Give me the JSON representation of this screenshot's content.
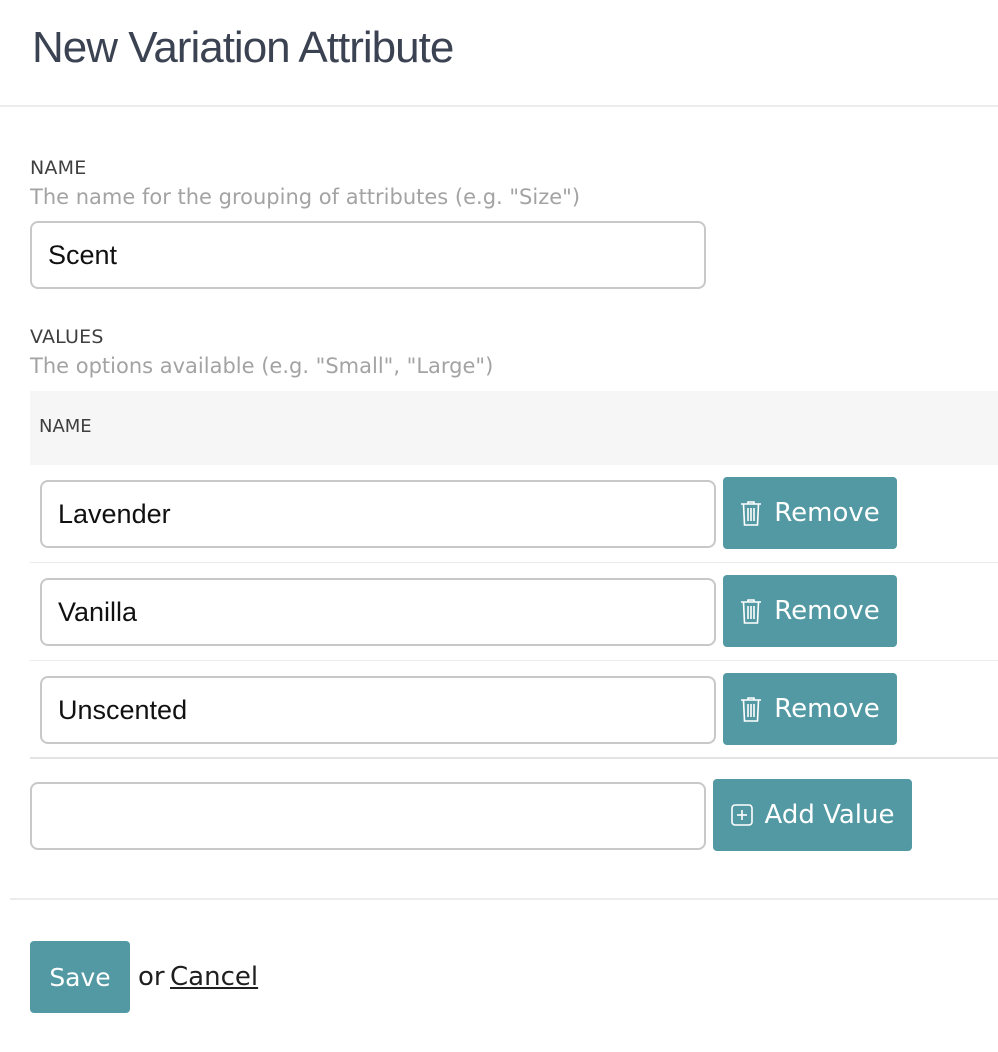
{
  "header": {
    "title": "New Variation Attribute"
  },
  "name_field": {
    "label": "NAME",
    "help": "The name for the grouping of attributes (e.g. \"Size\")",
    "value": "Scent"
  },
  "values_field": {
    "label": "VALUES",
    "help": "The options available (e.g. \"Small\", \"Large\")",
    "column_header": "NAME",
    "rows": [
      {
        "value": "Lavender",
        "remove_label": "Remove"
      },
      {
        "value": "Vanilla",
        "remove_label": "Remove"
      },
      {
        "value": "Unscented",
        "remove_label": "Remove"
      }
    ],
    "new_value": "",
    "add_label": "Add Value"
  },
  "footer": {
    "save_label": "Save",
    "or_text": "or",
    "cancel_label": "Cancel"
  },
  "colors": {
    "accent": "#5399a4",
    "title": "#3b4252",
    "help_text": "#a3a3a3"
  },
  "icons": {
    "remove": "trash-icon",
    "add": "plus-square-icon"
  }
}
